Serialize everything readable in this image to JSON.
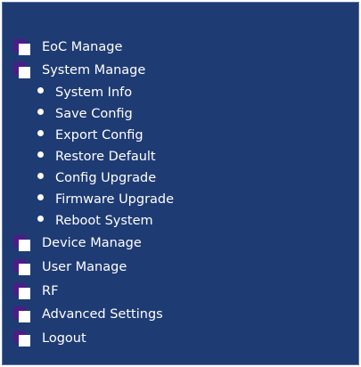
{
  "colors": {
    "panel_bg": "#1f3b73",
    "text": "#ffffff",
    "icon_purple": "#4b1d86",
    "icon_white": "#ffffff"
  },
  "menu": {
    "eoc_manage": "EoC Manage",
    "system_manage": "System Manage",
    "system_items": [
      "System Info",
      "Save Config",
      "Export Config",
      "Restore Default",
      "Config Upgrade",
      "Firmware Upgrade",
      "Reboot System"
    ],
    "device_manage": "Device Manage",
    "user_manage": "User Manage",
    "rf": "RF",
    "advanced_settings": "Advanced Settings",
    "logout": "Logout"
  }
}
